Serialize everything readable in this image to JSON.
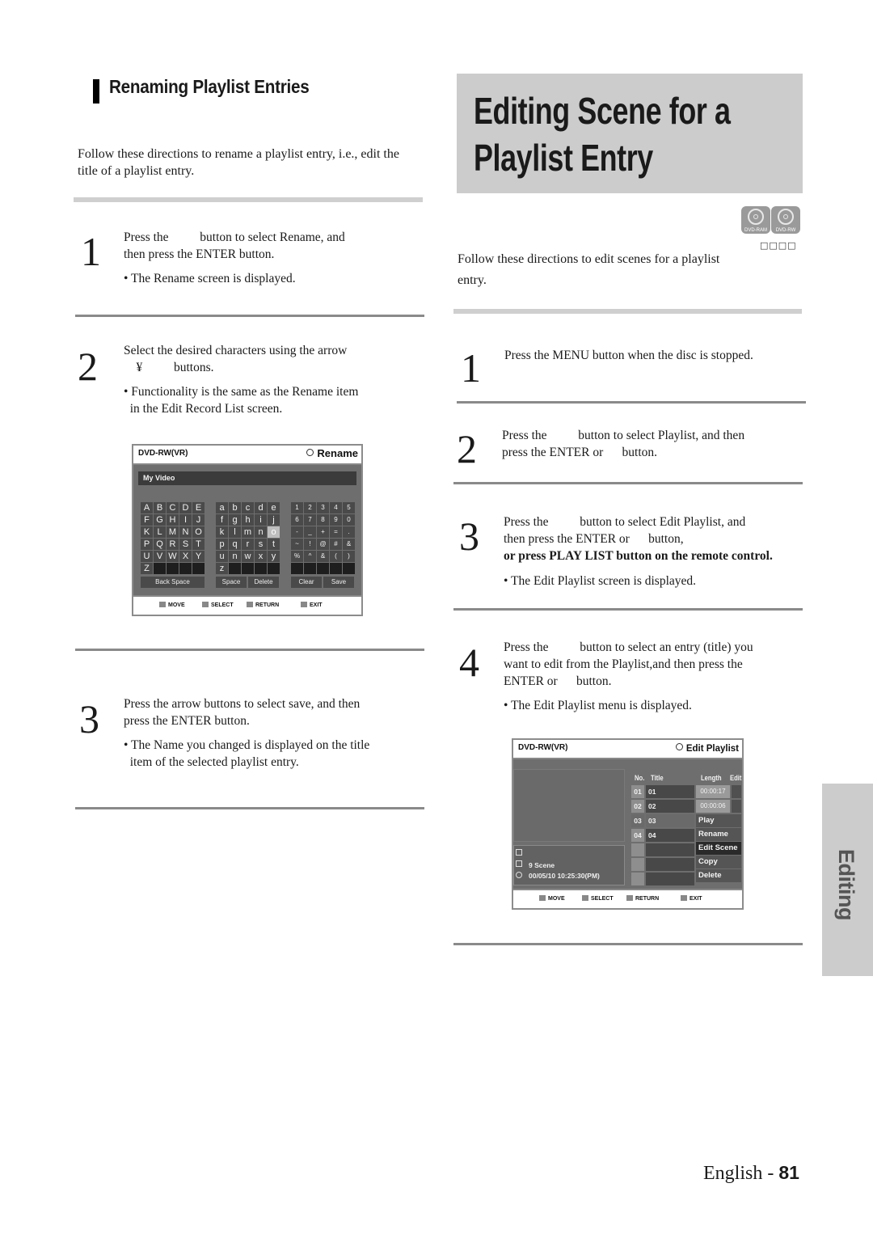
{
  "left_section": {
    "heading": "Renaming Playlist Entries",
    "intro": "Follow these directions to rename a playlist entry, i.e., edit the title of a playlist entry.",
    "steps": [
      {
        "number": "1",
        "line1": "Press the          button to select Rename, and",
        "line2": "then press the ENTER button.",
        "bullets": [
          "• The Rename screen is displayed."
        ]
      },
      {
        "number": "2",
        "line1": "Select the desired characters using the arrow",
        "line2": "    ¥          buttons.",
        "bullets": [
          "• Functionality is the same as the Rename item",
          "  in the Edit Record List screen."
        ]
      },
      {
        "number": "3",
        "line1": "Press the arrow buttons to select save, and then",
        "line2": "press the ENTER button.",
        "bullets": [
          "• The Name you changed is displayed on the title",
          "  item of the selected playlist entry."
        ]
      }
    ]
  },
  "rename_screen": {
    "model": "DVD-RW(VR)",
    "mode": "Rename",
    "name_value": "My Video",
    "upper": [
      "A",
      "B",
      "C",
      "D",
      "E",
      "F",
      "G",
      "H",
      "I",
      "J",
      "K",
      "L",
      "M",
      "N",
      "O",
      "P",
      "Q",
      "R",
      "S",
      "T",
      "U",
      "V",
      "W",
      "X",
      "Y",
      "Z",
      "",
      "",
      "",
      ""
    ],
    "lower": [
      "a",
      "b",
      "c",
      "d",
      "e",
      "f",
      "g",
      "h",
      "i",
      "j",
      "k",
      "l",
      "m",
      "n",
      "o",
      "p",
      "q",
      "r",
      "s",
      "t",
      "u",
      "n",
      "w",
      "x",
      "y",
      "z",
      "",
      "",
      "",
      ""
    ],
    "symbols": [
      "1",
      "2",
      "3",
      "4",
      "5",
      "6",
      "7",
      "8",
      "9",
      "0",
      "-",
      "_",
      "+",
      "=",
      ".",
      "~",
      "!",
      "@",
      "#",
      "&",
      "%",
      "^",
      "&",
      "(",
      ")",
      "",
      "",
      "",
      "",
      ""
    ],
    "selected_key": "o",
    "buttons": {
      "back_space": "Back Space",
      "space": "Space",
      "delete": "Delete",
      "clear": "Clear",
      "save": "Save"
    },
    "footer": {
      "move": "MOVE",
      "select": "SELECT",
      "return": "RETURN",
      "exit": "EXIT"
    }
  },
  "right_section": {
    "title_line1": "Editing Scene for a",
    "title_line2": "Playlist Entry",
    "disc_badges": [
      "DVD-RAM",
      "DVD-RW"
    ],
    "badge_boxes": "□□□□",
    "intro_line1": "Follow these directions to edit scenes for a playlist",
    "intro_line2": "entry.",
    "steps": [
      {
        "number": "1",
        "lines": [
          "Press the MENU button when the disc is stopped."
        ],
        "bold_line": "",
        "bullets": []
      },
      {
        "number": "2",
        "lines": [
          "Press the          button to select Playlist, and then",
          "press the ENTER or      button."
        ],
        "bold_line": "",
        "bullets": []
      },
      {
        "number": "3",
        "lines": [
          "Press the          button to select Edit Playlist, and",
          "then press the ENTER or      button,"
        ],
        "bold_line": "or press PLAY LIST button on the remote control.",
        "bullets": [
          "• The Edit Playlist screen is displayed."
        ]
      },
      {
        "number": "4",
        "lines": [
          "Press the          button to select an entry (title) you",
          "want to edit from the Playlist,and then press the",
          "ENTER or      button."
        ],
        "bold_line": "",
        "bullets": [
          "• The Edit Playlist menu is displayed."
        ]
      }
    ]
  },
  "playlist_screen": {
    "model": "DVD-RW(VR)",
    "mode": "Edit Playlist",
    "columns": {
      "no": "No.",
      "title": "Title",
      "length": "Length",
      "edit": "Edit"
    },
    "rows": [
      {
        "no": "01",
        "title": "01",
        "length": "00:00:17"
      },
      {
        "no": "02",
        "title": "02",
        "length": "00:00:06"
      },
      {
        "no": "03",
        "title": "03",
        "length": ""
      },
      {
        "no": "04",
        "title": "04",
        "length": ""
      }
    ],
    "context_menu": [
      "Play",
      "Rename",
      "Edit Scene",
      "Copy",
      "Delete"
    ],
    "selected_menu_item": "Edit Scene",
    "info": {
      "scenes": "9 Scene",
      "datetime": "00/05/10   10:25:30(PM)"
    },
    "footer": {
      "move": "MOVE",
      "select": "SELECT",
      "return": "RETURN",
      "exit": "EXIT"
    }
  },
  "side_tab": "Editing",
  "footer": {
    "language": "English - ",
    "page": "81"
  }
}
